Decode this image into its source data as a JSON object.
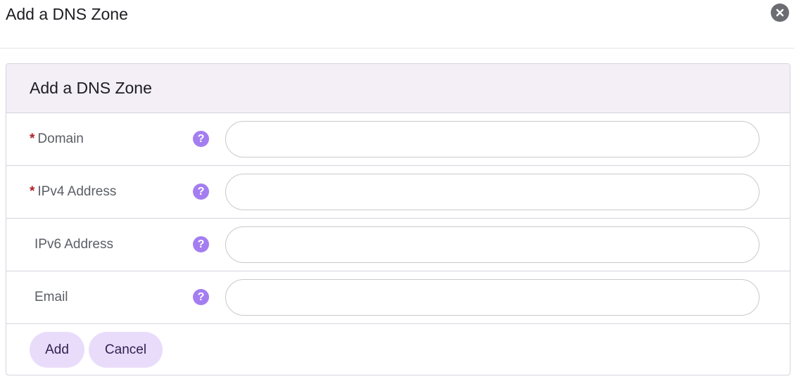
{
  "dialog": {
    "title": "Add a DNS Zone"
  },
  "panel": {
    "title": "Add a DNS Zone"
  },
  "fields": [
    {
      "label": "Domain",
      "required": true,
      "value": "",
      "placeholder": ""
    },
    {
      "label": "IPv4 Address",
      "required": true,
      "value": "",
      "placeholder": ""
    },
    {
      "label": "IPv6 Address",
      "required": false,
      "value": "",
      "placeholder": ""
    },
    {
      "label": "Email",
      "required": false,
      "value": "",
      "placeholder": ""
    }
  ],
  "required_mark": "*",
  "help_glyph": "?",
  "actions": {
    "add_label": "Add",
    "cancel_label": "Cancel"
  },
  "icons": {
    "close": "close-icon",
    "help": "help-icon"
  },
  "colors": {
    "accent": "#a47ef0",
    "button_bg": "#e9dcfb",
    "panel_header_bg": "#f4eff7",
    "required": "#b0202a"
  }
}
